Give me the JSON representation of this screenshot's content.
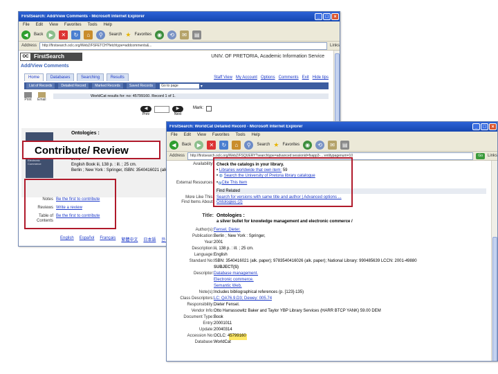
{
  "back_window": {
    "title": "FirstSearch: Add/View Comments - Microsoft Internet Explorer",
    "menu": [
      "File",
      "Edit",
      "View",
      "Favorites",
      "Tools",
      "Help"
    ],
    "toolbar": {
      "back": "Back",
      "search": "Search",
      "favorites": "Favorites"
    },
    "address_label": "Address",
    "address": "http://firstsearch.oclc.org/WebZ/FSFETCH?fetchtype=addcomments&...",
    "links_label": "Links",
    "brand": "FirstSearch",
    "institution": "UNIV. OF PRETORIA, Academic Information Service",
    "page_title": "Add/View Comments",
    "tabs": [
      "Home",
      "Databases",
      "Searching",
      "Results"
    ],
    "toplinks": [
      "Staff View",
      "My Account",
      "Options",
      "Comments",
      "Exit",
      "Hide tips"
    ],
    "subbuttons": [
      "List of Records",
      "Detailed Record",
      "Marked Records",
      "Saved Records"
    ],
    "goto_page": "Go to page",
    "tool_labels": [
      "Print",
      "Email"
    ],
    "results_text": "WorldCat results for: no: 45799160.  Record 1 of 1.",
    "pager": {
      "prev": "Prev",
      "next": "Next",
      "mark": "Mark:"
    },
    "record": {
      "title": "Ontologies :",
      "year": "2001",
      "lang_line": "English  Book  iii, 138 p. : ill. ; 25 cm.",
      "pub_line": "Berlin ; New York : Springer,  ISBN: 3540416021 (alk."
    },
    "cover_text": "Ontologies: A Silver Bullet for Knowledge Management and Electronic Commerce",
    "contribute_title": "Contribute/ Review",
    "comment_rows": [
      {
        "label": "Notes",
        "link": "Be the first to contribute"
      },
      {
        "label": "Reviews",
        "link": "Write a review"
      },
      {
        "label": "Table of Contents",
        "link": "Be the first to contribute"
      }
    ],
    "footer_links": [
      "English",
      "Español",
      "Français",
      "繁體中文",
      "日本語",
      "한국어"
    ]
  },
  "front_window": {
    "title": "FirstSearch: WorldCat Detailed Record - Microsoft Internet Explorer",
    "menu": [
      "File",
      "Edit",
      "View",
      "Favorites",
      "Tools",
      "Help"
    ],
    "toolbar": {
      "back": "Back",
      "search": "Search",
      "favorites": "Favorites"
    },
    "address_label": "Address",
    "address": "http://firstsearch.oclc.org/WebZ/FSQUERY?searchtype=advanced:sessionid=fsapp3-...:entitypagenum=10",
    "go": "Go",
    "links_label": "Links",
    "availability_label": "Availability:",
    "availability_heading": "Check the catalogs in your library.",
    "availability_items": [
      {
        "text": "Libraries worldwide that own item:",
        "count": "59"
      },
      {
        "text": "Search the University of Pretoria library catalogue",
        "count": ""
      }
    ],
    "external_label": "External Resources:",
    "external_link": "Cite This Item",
    "find_related": "Find Related",
    "more_like_label": "More Like This:",
    "more_like_link": "Search for versions with same title and author | Advanced options ...",
    "find_items_label": "Find Items About:",
    "find_items_link": "Ontologies (2)",
    "title_label": "Title:",
    "title_main": "Ontologies :",
    "title_sub": "a silver bullet for knowledge management and electronic commerce /",
    "rows": [
      {
        "label": "Author(s):",
        "value": "Fensel, Dieter.",
        "link": true
      },
      {
        "label": "Publication:",
        "value": "Berlin ; New York : Springer,",
        "link": false
      },
      {
        "label": "Year:",
        "value": "2001",
        "link": false
      },
      {
        "label": "Description:",
        "value": "iii, 138 p. : ill. ; 25 cm.",
        "link": false
      },
      {
        "label": "Language:",
        "value": "English",
        "link": false
      },
      {
        "label": "Standard No:",
        "value": "ISBN: 3540416021 (alk. paper); 9783540416026 (alk. paper); National Library: 990485639 LCCN: 2001-49880",
        "link": false
      },
      {
        "label": "",
        "value": "SUBJECT(S)",
        "link": false
      },
      {
        "label": "Descriptor:",
        "value": "Database management.",
        "link": true
      },
      {
        "label": "",
        "value": "Electronic commerce.",
        "link": true
      },
      {
        "label": "",
        "value": "Semantic Web.",
        "link": true
      },
      {
        "label": "Note(s):",
        "value": "Includes bibliographical references (p. [123]-135)",
        "link": false
      },
      {
        "label": "Class Descriptors:",
        "value": "LC: QA76.9.D3; Dewey: 005.74",
        "link": true
      },
      {
        "label": "Responsibility:",
        "value": "Dieter Fensel.",
        "link": false
      },
      {
        "label": "Vendor Info:",
        "value": "Otto Harrassowitz Baker and Taylor YBP Library Services (HARR BTCP YANK) 59.00 DEM",
        "link": false
      },
      {
        "label": "Document Type:",
        "value": "Book",
        "link": false
      },
      {
        "label": "Entry:",
        "value": "20001011",
        "link": false
      },
      {
        "label": "Update:",
        "value": "20040314",
        "link": false
      },
      {
        "label": "Accession No:",
        "value": "OCLC: 45799160",
        "link": false
      },
      {
        "label": "Database:",
        "value": "WorldCat",
        "link": false
      }
    ]
  }
}
